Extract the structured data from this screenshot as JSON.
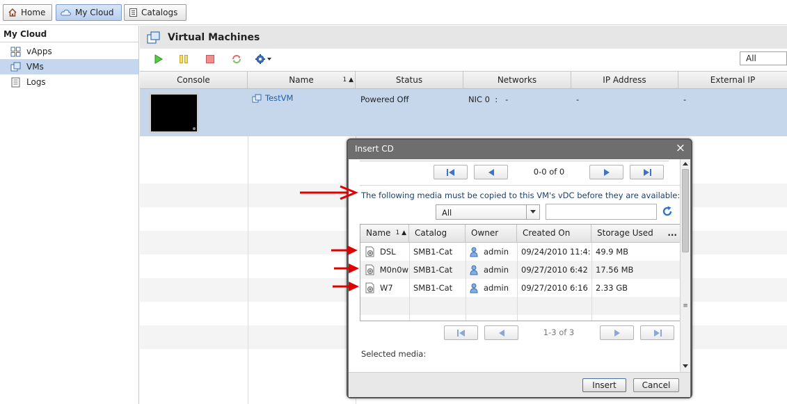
{
  "nav": {
    "tabs": [
      "Home",
      "My Cloud",
      "Catalogs"
    ]
  },
  "sidebar": {
    "title": "My Cloud",
    "items": [
      {
        "label": "vApps",
        "icon": "vapps-grid-icon"
      },
      {
        "label": "VMs",
        "icon": "vm-icon"
      },
      {
        "label": "Logs",
        "icon": "log-document-icon"
      }
    ]
  },
  "main": {
    "title": "Virtual Machines",
    "toolbar": {
      "filter": "All",
      "buttons": [
        "power-on",
        "suspend",
        "power-off",
        "reset",
        "actions"
      ]
    },
    "columns": [
      "Console",
      "Name",
      "Status",
      "Networks",
      "IP Address",
      "External IP"
    ],
    "name_sort": "1",
    "rows": [
      {
        "name": "TestVM",
        "status": "Powered Off",
        "networks": "NIC 0  :   -",
        "ip": "-",
        "external_ip": "-"
      }
    ]
  },
  "dialog": {
    "title": "Insert CD",
    "top_pager": "0-0 of 0",
    "notice": "The following media must be copied to this VM's vDC before they are available:",
    "catalog_filter": "All",
    "search_value": "",
    "columns": [
      "Name",
      "Catalog",
      "Owner",
      "Created On",
      "Storage Used",
      "..."
    ],
    "name_sort": "1",
    "media": [
      {
        "name": "DSL",
        "catalog": "SMB1-Cat",
        "owner": "admin",
        "created": "09/24/2010 11:4:",
        "storage": "49.9 MB"
      },
      {
        "name": "M0n0w",
        "catalog": "SMB1-Cat",
        "owner": "admin",
        "created": "09/27/2010 6:42",
        "storage": "17.56 MB"
      },
      {
        "name": "W7",
        "catalog": "SMB1-Cat",
        "owner": "admin",
        "created": "09/27/2010 6:16",
        "storage": "2.33 GB"
      }
    ],
    "bottom_pager": "1-3 of 3",
    "selected_label": "Selected media:",
    "insert_label": "Insert",
    "cancel_label": "Cancel"
  },
  "colors": {
    "selection": "#c6d7ec",
    "link": "#1f5fa8",
    "annotation_arrow": "#e00000",
    "dialog_frame": "#6e6e6e"
  }
}
